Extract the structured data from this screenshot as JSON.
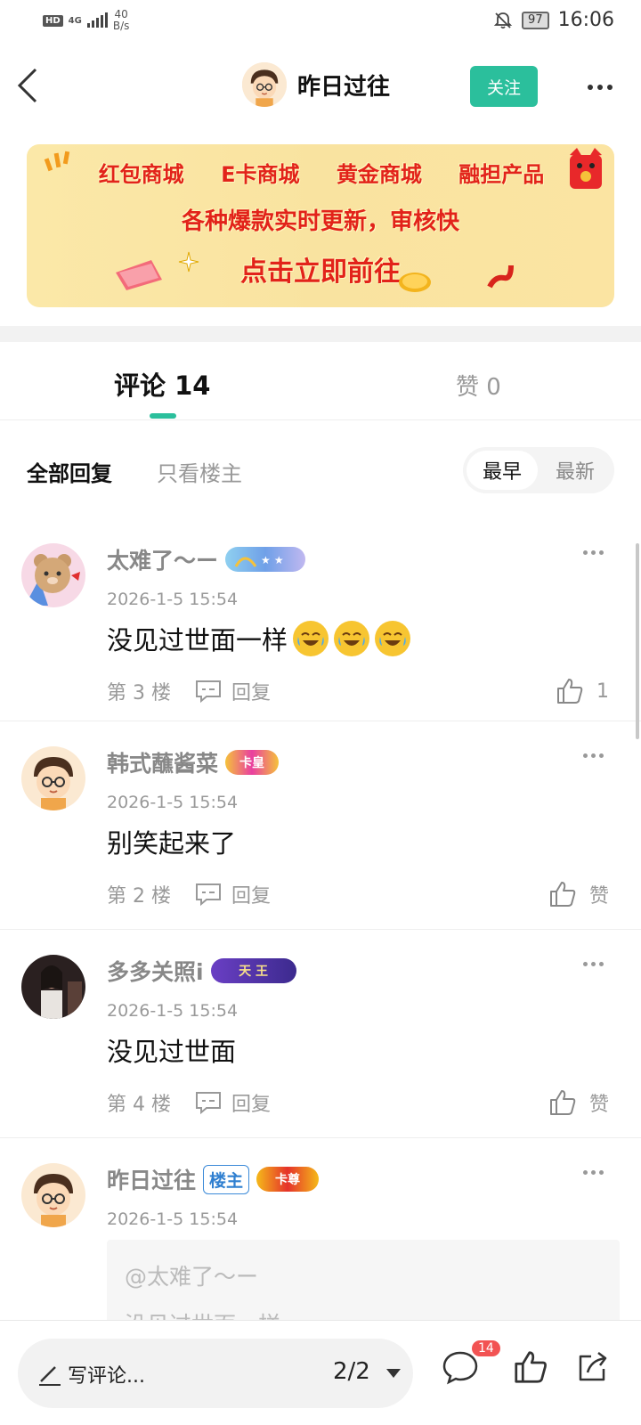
{
  "status_bar": {
    "hd": "HD",
    "network": "4G",
    "speed_value": "40",
    "speed_unit": "B/s",
    "battery": "97",
    "time": "16:06"
  },
  "header": {
    "title": "昨日过往",
    "follow_label": "关注"
  },
  "banner": {
    "row1": [
      "红包商城",
      "E卡商城",
      "黄金商城",
      "融担产品"
    ],
    "row2": "各种爆款实时更新，审核快",
    "row3": "点击立即前往"
  },
  "tabs": {
    "comments_label": "评论 14",
    "likes_label": "赞 0"
  },
  "filters": {
    "all": "全部回复",
    "op_only": "只看楼主",
    "sort_earliest": "最早",
    "sort_latest": "最新"
  },
  "comments": [
    {
      "name": "太难了～ー",
      "time": "2026-1-5 15:54",
      "text": "没见过世面一样",
      "emoji_count": 3,
      "floor": "第 3 楼",
      "reply_label": "回复",
      "likes": "1"
    },
    {
      "name": "韩式蘸酱菜",
      "badge": "卡皇",
      "time": "2026-1-5 15:54",
      "text": "别笑起来了",
      "floor": "第 2 楼",
      "reply_label": "回复",
      "likes": "赞"
    },
    {
      "name": "多多关照i",
      "badge": "天 王",
      "time": "2026-1-5 15:54",
      "text": "没见过世面",
      "floor": "第 4 楼",
      "reply_label": "回复",
      "likes": "赞"
    },
    {
      "name": "昨日过往",
      "op_tag": "楼主",
      "badge": "卡尊",
      "time": "2026-1-5 15:54",
      "quote_user": "@太难了～ー",
      "quote_text": "没见过世面一样"
    }
  ],
  "bottom_bar": {
    "placeholder": "写评论...",
    "page": "2/2",
    "comment_count": "14"
  },
  "colors": {
    "accent": "#2bbf9c",
    "banner_text": "#e2231a",
    "badge_red": "#f25353"
  }
}
